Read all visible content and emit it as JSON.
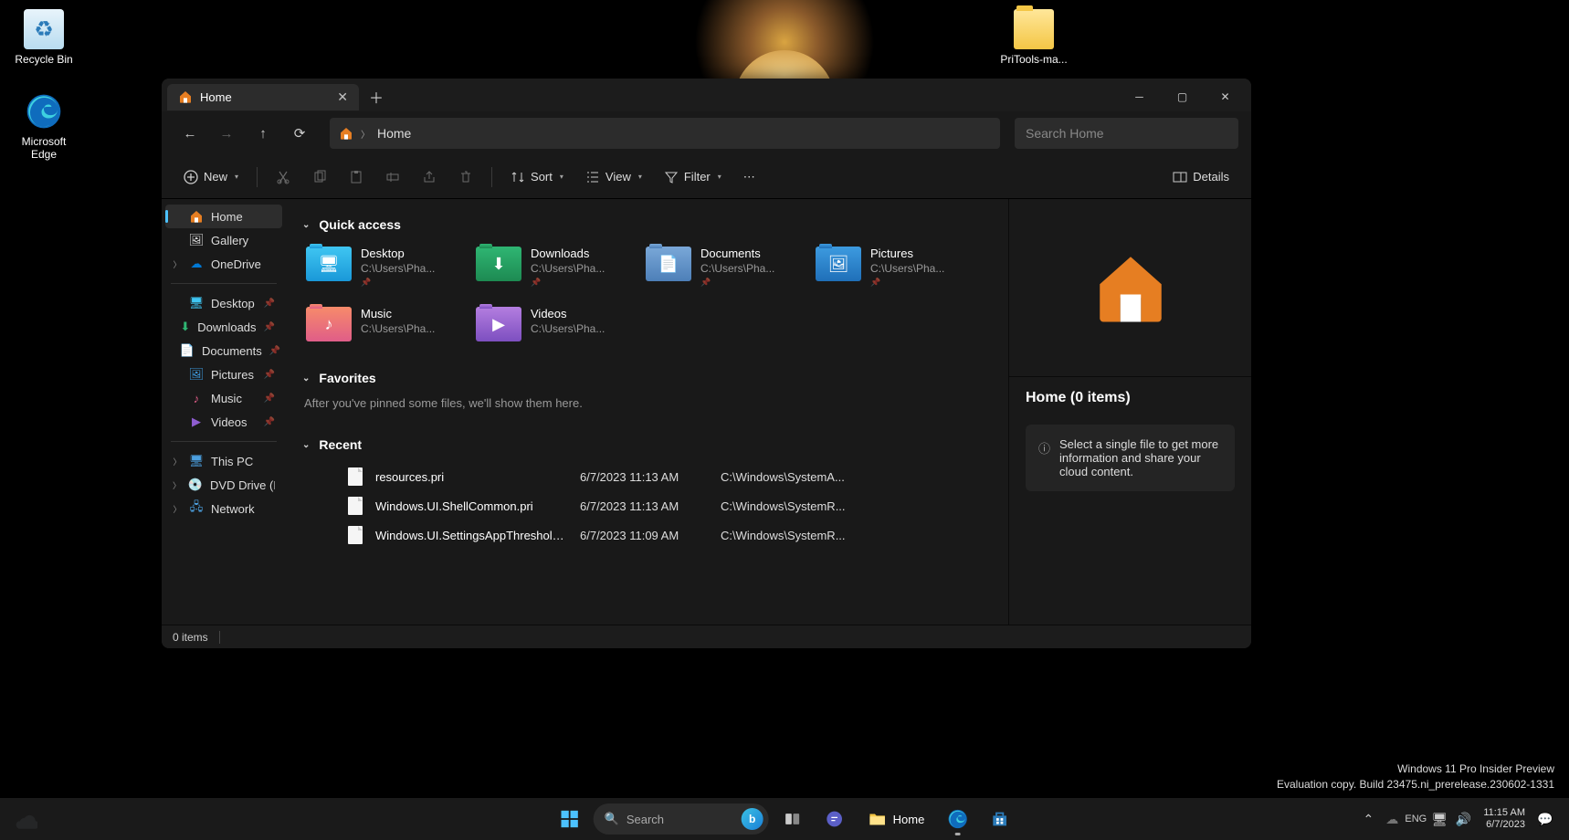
{
  "desktop": {
    "recycle": "Recycle Bin",
    "edge": "Microsoft Edge",
    "pritools": "PriTools-ma..."
  },
  "explorer": {
    "tab": "Home",
    "breadcrumb": "Home",
    "search_placeholder": "Search Home",
    "toolbar": {
      "new": "New",
      "sort": "Sort",
      "view": "View",
      "filter": "Filter",
      "details": "Details"
    },
    "sidebar": {
      "home": "Home",
      "gallery": "Gallery",
      "onedrive": "OneDrive",
      "desktop": "Desktop",
      "downloads": "Downloads",
      "documents": "Documents",
      "pictures": "Pictures",
      "music": "Music",
      "videos": "Videos",
      "thispc": "This PC",
      "dvd": "DVD Drive (D:) VMw",
      "network": "Network"
    },
    "sections": {
      "quick_access": "Quick access",
      "favorites": "Favorites",
      "recent": "Recent"
    },
    "quick_access": [
      {
        "name": "Desktop",
        "path": "C:\\Users\\Pha...",
        "pinned": true,
        "kind": "desk",
        "glyph": "🖥"
      },
      {
        "name": "Downloads",
        "path": "C:\\Users\\Pha...",
        "pinned": true,
        "kind": "down",
        "glyph": "⬇"
      },
      {
        "name": "Documents",
        "path": "C:\\Users\\Pha...",
        "pinned": true,
        "kind": "doc",
        "glyph": "📄"
      },
      {
        "name": "Pictures",
        "path": "C:\\Users\\Pha...",
        "pinned": true,
        "kind": "pic",
        "glyph": "🖼"
      },
      {
        "name": "Music",
        "path": "C:\\Users\\Pha...",
        "pinned": false,
        "kind": "mus",
        "glyph": "♪"
      },
      {
        "name": "Videos",
        "path": "C:\\Users\\Pha...",
        "pinned": false,
        "kind": "vid",
        "glyph": "▶"
      }
    ],
    "favorites_empty": "After you've pinned some files, we'll show them here.",
    "recent": [
      {
        "name": "resources.pri",
        "date": "6/7/2023 11:13 AM",
        "path": "C:\\Windows\\SystemA..."
      },
      {
        "name": "Windows.UI.ShellCommon.pri",
        "date": "6/7/2023 11:13 AM",
        "path": "C:\\Windows\\SystemR..."
      },
      {
        "name": "Windows.UI.SettingsAppThreshold....",
        "date": "6/7/2023 11:09 AM",
        "path": "C:\\Windows\\SystemR..."
      }
    ],
    "details_panel": {
      "title": "Home (0 items)",
      "tip": "Select a single file to get more information and share your cloud content."
    },
    "status": "0 items"
  },
  "taskbar": {
    "search": "Search",
    "explorer_label": "Home"
  },
  "watermark": {
    "line1": "Windows 11 Pro Insider Preview",
    "line2": "Evaluation copy. Build 23475.ni_prerelease.230602-1331"
  },
  "clock": {
    "time": "11:15 AM",
    "date": "6/7/2023"
  }
}
